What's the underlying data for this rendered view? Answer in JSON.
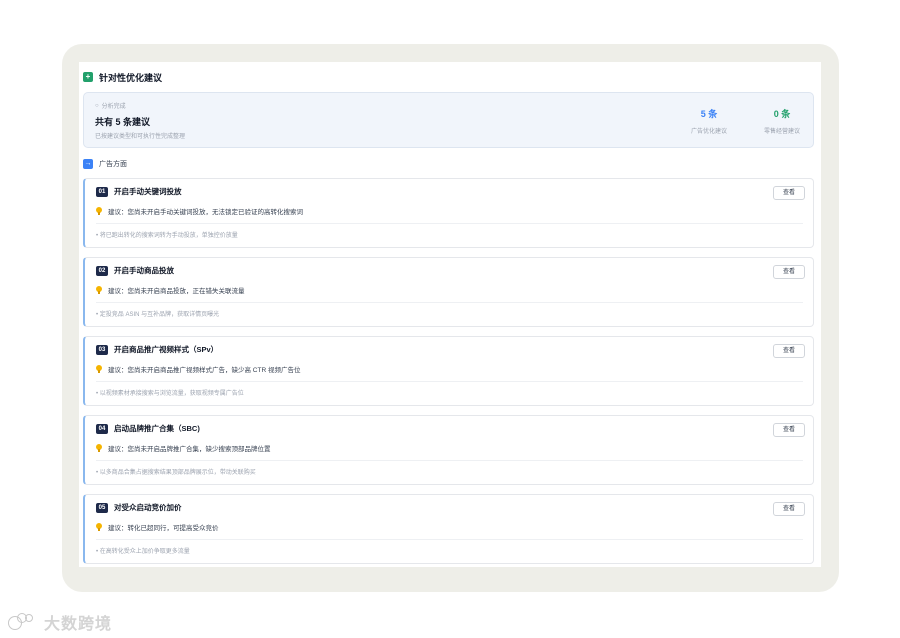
{
  "header": {
    "title": "针对性优化建议",
    "icon": "plus-square-icon",
    "icon_color": "#22a06b"
  },
  "summary": {
    "status": "分析完成",
    "title": "共有 5 条建议",
    "subtitle": "已按建议类型和可执行性完成整理",
    "stats": [
      {
        "value": "5 条",
        "label": "广告优化建议",
        "color": "#3b82f6"
      },
      {
        "value": "0 条",
        "label": "零售经营建议",
        "color": "#22a06b"
      }
    ]
  },
  "section": {
    "title": "广告方面",
    "icon": "arrow-right-icon",
    "icon_color": "#3b82f6"
  },
  "cards": [
    {
      "no": "01",
      "title": "开启手动关键词投放",
      "suggestion": "建议：您尚未开启手动关键词投放，无法锁定已验证的高转化搜索词",
      "note": "将已跑出转化的搜索词转为手动投放，单独控价放量",
      "button": "查看"
    },
    {
      "no": "02",
      "title": "开启手动商品投放",
      "suggestion": "建议：您尚未开启商品投放，正在错失关联流量",
      "note": "定投竞品 ASIN 与互补品牌，获取详情页曝光",
      "button": "查看"
    },
    {
      "no": "03",
      "title": "开启商品推广视频样式（SPv）",
      "suggestion": "建议：您尚未开启商品推广视频样式广告，缺少高 CTR 视频广告位",
      "note": "以视频素材承接搜索与浏览流量，获取视频专属广告位",
      "button": "查看"
    },
    {
      "no": "04",
      "title": "启动品牌推广合集（SBC)",
      "suggestion": "建议：您尚未开启品牌推广合集，缺少搜索顶部品牌位置",
      "note": "以多商品合集占据搜索结果顶部品牌展示位，带动关联购买",
      "button": "查看"
    },
    {
      "no": "05",
      "title": "对受众启动竞价加价",
      "suggestion": "建议：转化已超同行，可提高受众竞价",
      "note": "在高转化受众上加价争取更多流量",
      "button": "查看"
    }
  ],
  "watermark": {
    "text": "大数跨境"
  }
}
